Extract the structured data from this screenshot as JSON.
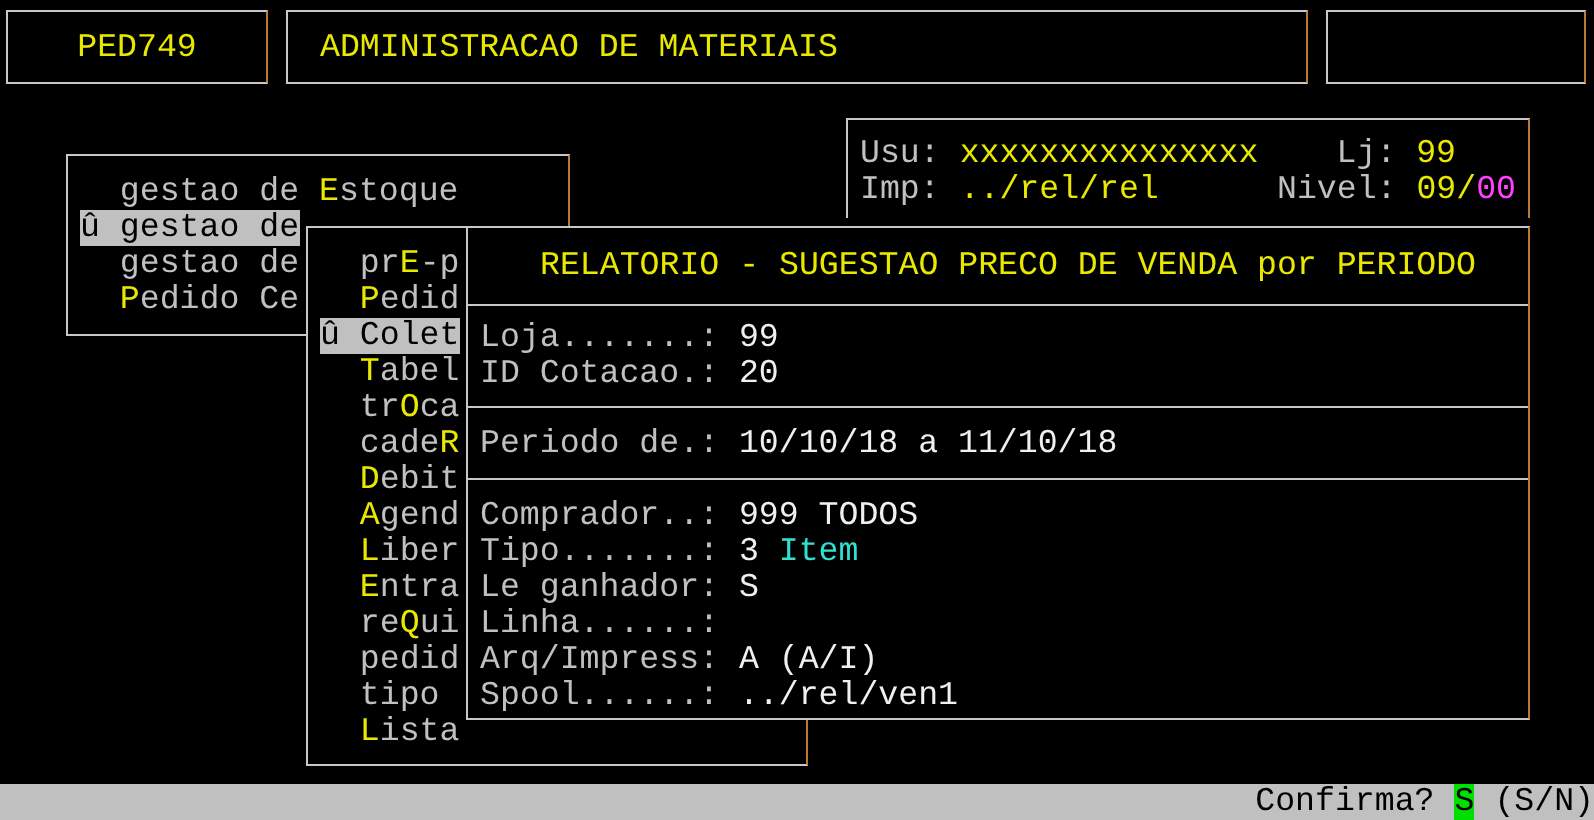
{
  "header": {
    "program": "PED749",
    "title": "ADMINISTRACAO DE MATERIAIS"
  },
  "session": {
    "user_label": "Usu:",
    "user": "xxxxxxxxxxxxxxx",
    "store_label": "Lj:",
    "store": "99",
    "printer_label": "Imp:",
    "printer": "../rel/rel",
    "nivel_label": "Nivel:",
    "nivel": "09/",
    "nivel_sub": "00"
  },
  "menus": [
    {
      "marker": "û",
      "items": [
        {
          "before": "gestao de ",
          "key": "E",
          "after": "stoque",
          "selected": false
        },
        {
          "before": "gestao de",
          "selected": true
        },
        {
          "before": "gestao de",
          "selected": false
        },
        {
          "key": "P",
          "after": "edido Ce",
          "selected": false
        }
      ]
    },
    {
      "marker": "û",
      "items": [
        {
          "before": "pr",
          "key": "E",
          "after": "-p",
          "selected": false
        },
        {
          "key": "P",
          "after": "edid",
          "selected": false
        },
        {
          "before": "Colet",
          "selected": true
        },
        {
          "key": "T",
          "after": "abel",
          "selected": false
        },
        {
          "before": "tr",
          "key": "O",
          "after": "ca",
          "selected": false
        },
        {
          "before": "cade",
          "key": "R",
          "selected": false
        },
        {
          "key": "D",
          "after": "ebit",
          "selected": false
        },
        {
          "key": "A",
          "after": "gend",
          "selected": false
        },
        {
          "key": "L",
          "after": "iber",
          "selected": false
        },
        {
          "key": "E",
          "after": "ntra",
          "selected": false
        },
        {
          "before": "re",
          "key": "Q",
          "after": "ui",
          "selected": false
        },
        {
          "before": "pedid",
          "selected": false
        },
        {
          "before": "tipo",
          "selected": false
        },
        {
          "key": "L",
          "after": "ista",
          "selected": false
        }
      ]
    }
  ],
  "report": {
    "title": "RELATORIO - SUGESTAO PRECO DE VENDA por PERIODO",
    "sections": [
      [
        {
          "label": "Loja.......:",
          "value": "99"
        },
        {
          "label": "ID Cotacao.:",
          "value": "20"
        }
      ],
      [
        {
          "label": "Periodo de.:",
          "value": "10/10/18 a 11/10/18"
        }
      ],
      [
        {
          "label": "Comprador..:",
          "value": "999 TODOS"
        },
        {
          "label": "Tipo.......:",
          "value": "3",
          "note": "Item"
        },
        {
          "label": "Le ganhador:",
          "value": "S"
        },
        {
          "label": "Linha......:"
        },
        {
          "label": "Arq/Impress:",
          "value": "A (A/I)"
        },
        {
          "label": "Spool......:",
          "value": "../rel/ven1"
        }
      ]
    ]
  },
  "status_bar": {
    "prompt": "Confirma?",
    "answer": "S",
    "options": "(S/N)"
  }
}
